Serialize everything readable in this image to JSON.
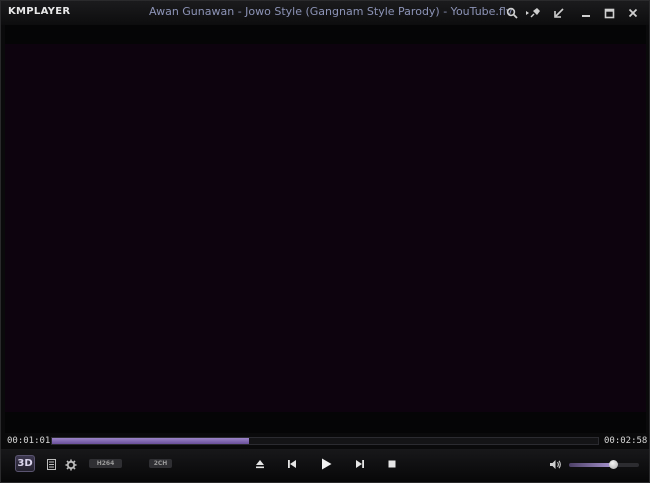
{
  "app": {
    "logo": "KMPLAYER",
    "title": "Awan Gunawan - Jowo Style (Gangnam Style Parody) - YouTube.flv"
  },
  "titlebar_icons": [
    "search-icon",
    "pin-icon",
    "mini-mode-icon",
    "minimize-icon",
    "maximize-icon",
    "close-icon"
  ],
  "playback": {
    "elapsed": "00:01:01",
    "total": "00:02:58",
    "progress_fraction": 0.36
  },
  "controls": {
    "badge_3d": "3D",
    "codec_badge": "H264",
    "channel_badge": "2CH",
    "volume_fraction": 0.63
  },
  "colors": {
    "accent": "#8a70bc",
    "title_text": "#8c93b6",
    "video_bg": "#0d030e"
  }
}
